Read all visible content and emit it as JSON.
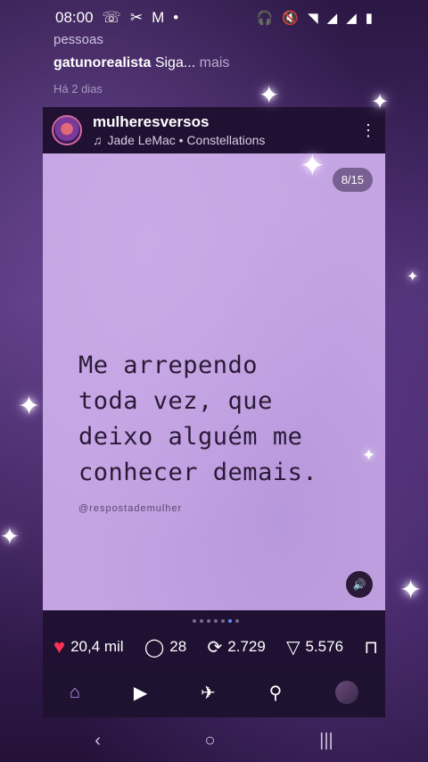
{
  "status": {
    "time": "08:00",
    "left_icons": [
      "whatsapp-icon",
      "tools-icon",
      "gmail-icon",
      "dot-icon"
    ],
    "right_icons": [
      "headphones-icon",
      "mute-icon",
      "wifi-icon",
      "signal-icon",
      "signal-icon",
      "battery-icon"
    ]
  },
  "comments": {
    "prev_line": "pessoas",
    "user": "gatunorealista",
    "text": "Siga...",
    "more": "mais",
    "time": "Há 2 dias"
  },
  "post": {
    "username": "mulheresversos",
    "music": "Jade LeMac • Constellations",
    "counter": "8/15",
    "quote_lines": [
      "Me arrependo",
      "toda vez, que",
      "deixo alguém me",
      "conhecer demais."
    ],
    "handle": "@respostademulher"
  },
  "actions": {
    "likes": "20,4 mil",
    "comments": "28",
    "reposts": "2.729",
    "shares": "5.576"
  },
  "nav": {
    "items": [
      "home-icon",
      "reels-icon",
      "send-icon",
      "search-icon",
      "profile-avatar"
    ]
  }
}
